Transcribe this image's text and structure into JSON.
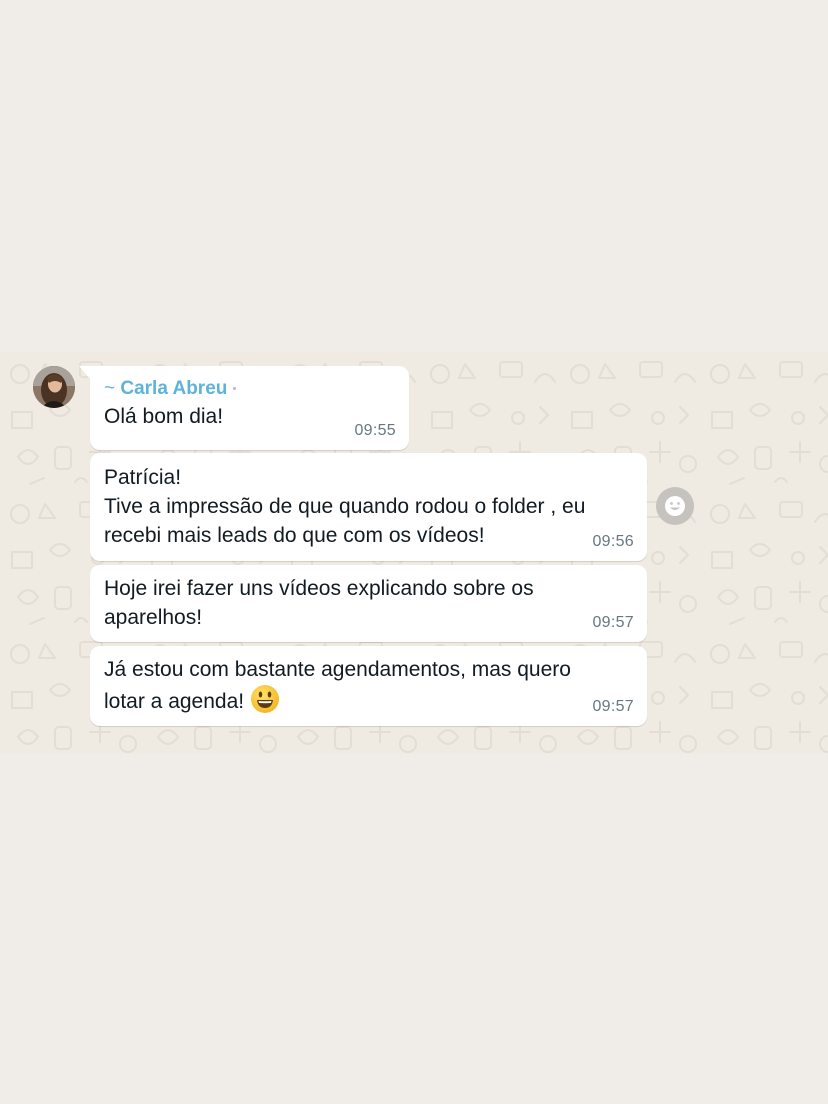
{
  "chat": {
    "messages": [
      {
        "sender": "Carla Abreu",
        "sender_prefix": "~ ",
        "text": "Olá bom dia!",
        "time": "09:55"
      },
      {
        "text": "Patrícia!\nTive a impressão de que quando rodou o folder , eu\nrecebi mais leads do que com os vídeos!",
        "time": "09:56"
      },
      {
        "text": "Hoje irei fazer uns vídeos explicando sobre os\naparelhos!",
        "time": "09:57"
      },
      {
        "text": "Já estou com bastante agendamentos, mas quero\nlotar a agenda!",
        "emoji": "smiley-face",
        "time": "09:57"
      }
    ]
  },
  "icons": {
    "reaction": "smiley-reaction-icon"
  },
  "colors": {
    "background": "#f0ede8",
    "bubble": "#ffffff",
    "sender_name": "#5fb3d9",
    "timestamp": "#667781"
  }
}
